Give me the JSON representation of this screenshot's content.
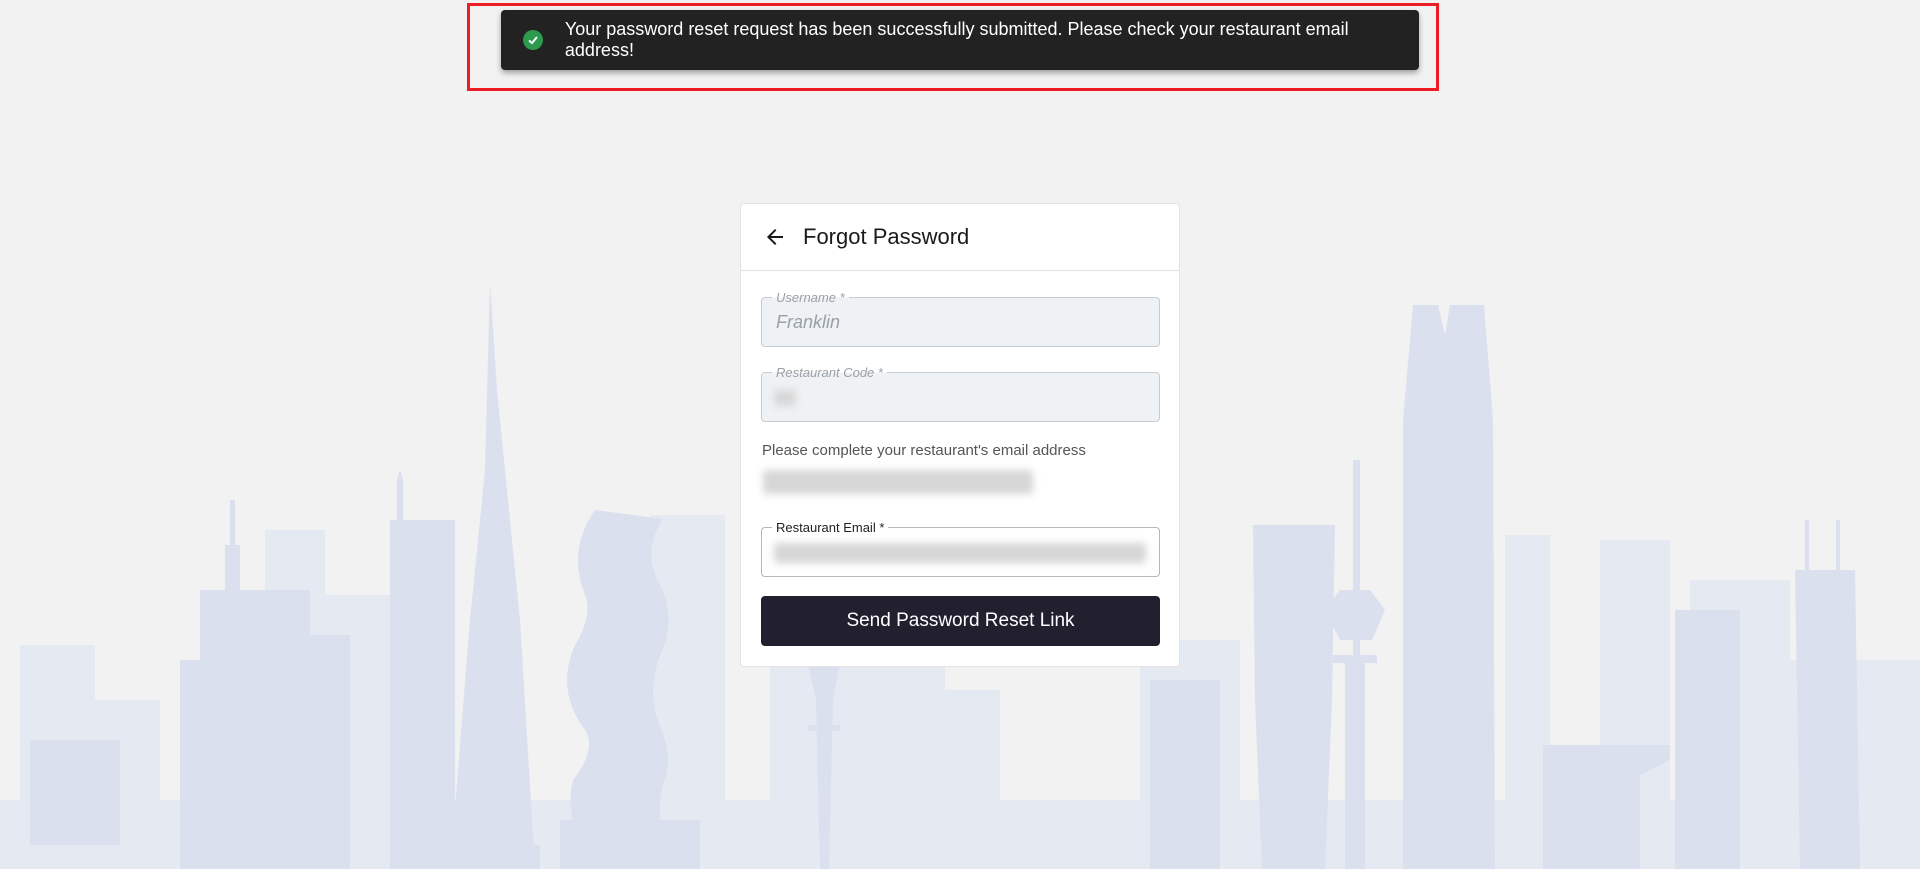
{
  "toast": {
    "message": "Your password reset request has been successfully submitted. Please check your restaurant email address!",
    "icon": "check-circle-icon",
    "status_color": "#2e9a4e"
  },
  "form": {
    "title": "Forgot Password",
    "back_icon": "arrow-left-icon",
    "username_label": "Username *",
    "username_value": "Franklin",
    "restaurant_code_label": "Restaurant Code *",
    "info_text": "Please complete your restaurant's email address",
    "email_label": "Restaurant Email *",
    "submit_label": "Send Password Reset Link"
  },
  "colors": {
    "button_bg": "#221f2e",
    "highlight_border": "#ee1c25",
    "skyline": "#dfe3ef"
  }
}
